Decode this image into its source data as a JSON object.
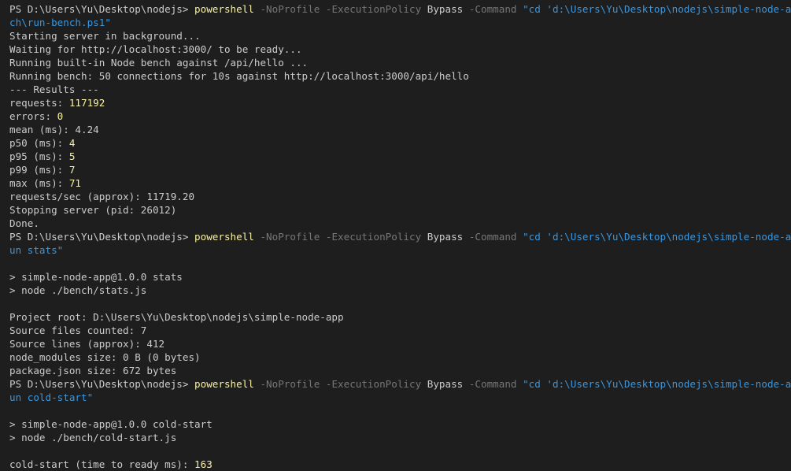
{
  "terminal": {
    "colors": {
      "background": "#1e1e1e",
      "text": "#cccccc",
      "command": "#f9f1a5",
      "parameter": "#767676",
      "string": "#3a96dd",
      "number": "#f9f1a5"
    },
    "lines": [
      [
        {
          "t": "PS D:\\Users\\Yu\\Desktop\\nodejs> ",
          "c": "plain"
        },
        {
          "t": "powershell",
          "c": "cmd"
        },
        {
          "t": " -NoProfile -ExecutionPolicy ",
          "c": "param"
        },
        {
          "t": "Bypass",
          "c": "plain"
        },
        {
          "t": " -Command ",
          "c": "param"
        },
        {
          "t": "\"cd 'd:\\Users\\Yu\\Desktop\\nodejs\\simple-node-app'; .\\ben",
          "c": "str"
        }
      ],
      [
        {
          "t": "ch\\run-bench.ps1\"",
          "c": "str"
        }
      ],
      [
        {
          "t": "Starting server in background...",
          "c": "plain"
        }
      ],
      [
        {
          "t": "Waiting for http://localhost:3000/ to be ready...",
          "c": "plain"
        }
      ],
      [
        {
          "t": "Running built-in Node bench against /api/hello ...",
          "c": "plain"
        }
      ],
      [
        {
          "t": "Running bench: 50 connections for 10s against http://localhost:3000/api/hello",
          "c": "plain"
        }
      ],
      [
        {
          "t": "--- Results ---",
          "c": "plain"
        }
      ],
      [
        {
          "t": "requests: ",
          "c": "plain"
        },
        {
          "t": "117192",
          "c": "num"
        }
      ],
      [
        {
          "t": "errors: ",
          "c": "plain"
        },
        {
          "t": "0",
          "c": "num"
        }
      ],
      [
        {
          "t": "mean (ms): 4.24",
          "c": "plain"
        }
      ],
      [
        {
          "t": "p50 (ms): ",
          "c": "plain"
        },
        {
          "t": "4",
          "c": "num"
        }
      ],
      [
        {
          "t": "p95 (ms): ",
          "c": "plain"
        },
        {
          "t": "5",
          "c": "num"
        }
      ],
      [
        {
          "t": "p99 (ms): ",
          "c": "plain"
        },
        {
          "t": "7",
          "c": "num"
        }
      ],
      [
        {
          "t": "max (ms): ",
          "c": "plain"
        },
        {
          "t": "71",
          "c": "num"
        }
      ],
      [
        {
          "t": "requests/sec (approx): 11719.20",
          "c": "plain"
        }
      ],
      [
        {
          "t": "Stopping server (pid: 26012)",
          "c": "plain"
        }
      ],
      [
        {
          "t": "Done.",
          "c": "plain"
        }
      ],
      [
        {
          "t": "PS D:\\Users\\Yu\\Desktop\\nodejs> ",
          "c": "plain"
        },
        {
          "t": "powershell",
          "c": "cmd"
        },
        {
          "t": " -NoProfile -ExecutionPolicy ",
          "c": "param"
        },
        {
          "t": "Bypass",
          "c": "plain"
        },
        {
          "t": " -Command ",
          "c": "param"
        },
        {
          "t": "\"cd 'd:\\Users\\Yu\\Desktop\\nodejs\\simple-node-app'; npm r",
          "c": "str"
        }
      ],
      [
        {
          "t": "un stats\"",
          "c": "str"
        }
      ],
      [],
      [
        {
          "t": "> simple-node-app@1.0.0 stats",
          "c": "plain"
        }
      ],
      [
        {
          "t": "> node ./bench/stats.js",
          "c": "plain"
        }
      ],
      [],
      [
        {
          "t": "Project root: D:\\Users\\Yu\\Desktop\\nodejs\\simple-node-app",
          "c": "plain"
        }
      ],
      [
        {
          "t": "Source files counted: 7",
          "c": "plain"
        }
      ],
      [
        {
          "t": "Source lines (approx): 412",
          "c": "plain"
        }
      ],
      [
        {
          "t": "node_modules size: 0 B (0 bytes)",
          "c": "plain"
        }
      ],
      [
        {
          "t": "package.json size: 672 bytes",
          "c": "plain"
        }
      ],
      [
        {
          "t": "PS D:\\Users\\Yu\\Desktop\\nodejs> ",
          "c": "plain"
        },
        {
          "t": "powershell",
          "c": "cmd"
        },
        {
          "t": " -NoProfile -ExecutionPolicy ",
          "c": "param"
        },
        {
          "t": "Bypass",
          "c": "plain"
        },
        {
          "t": " -Command ",
          "c": "param"
        },
        {
          "t": "\"cd 'd:\\Users\\Yu\\Desktop\\nodejs\\simple-node-app'; npm r",
          "c": "str"
        }
      ],
      [
        {
          "t": "un cold-start\"",
          "c": "str"
        }
      ],
      [],
      [
        {
          "t": "> simple-node-app@1.0.0 cold-start",
          "c": "plain"
        }
      ],
      [
        {
          "t": "> node ./bench/cold-start.js",
          "c": "plain"
        }
      ],
      [],
      [
        {
          "t": "cold-start (time to ready ms): ",
          "c": "plain"
        },
        {
          "t": "163",
          "c": "num"
        }
      ]
    ]
  }
}
